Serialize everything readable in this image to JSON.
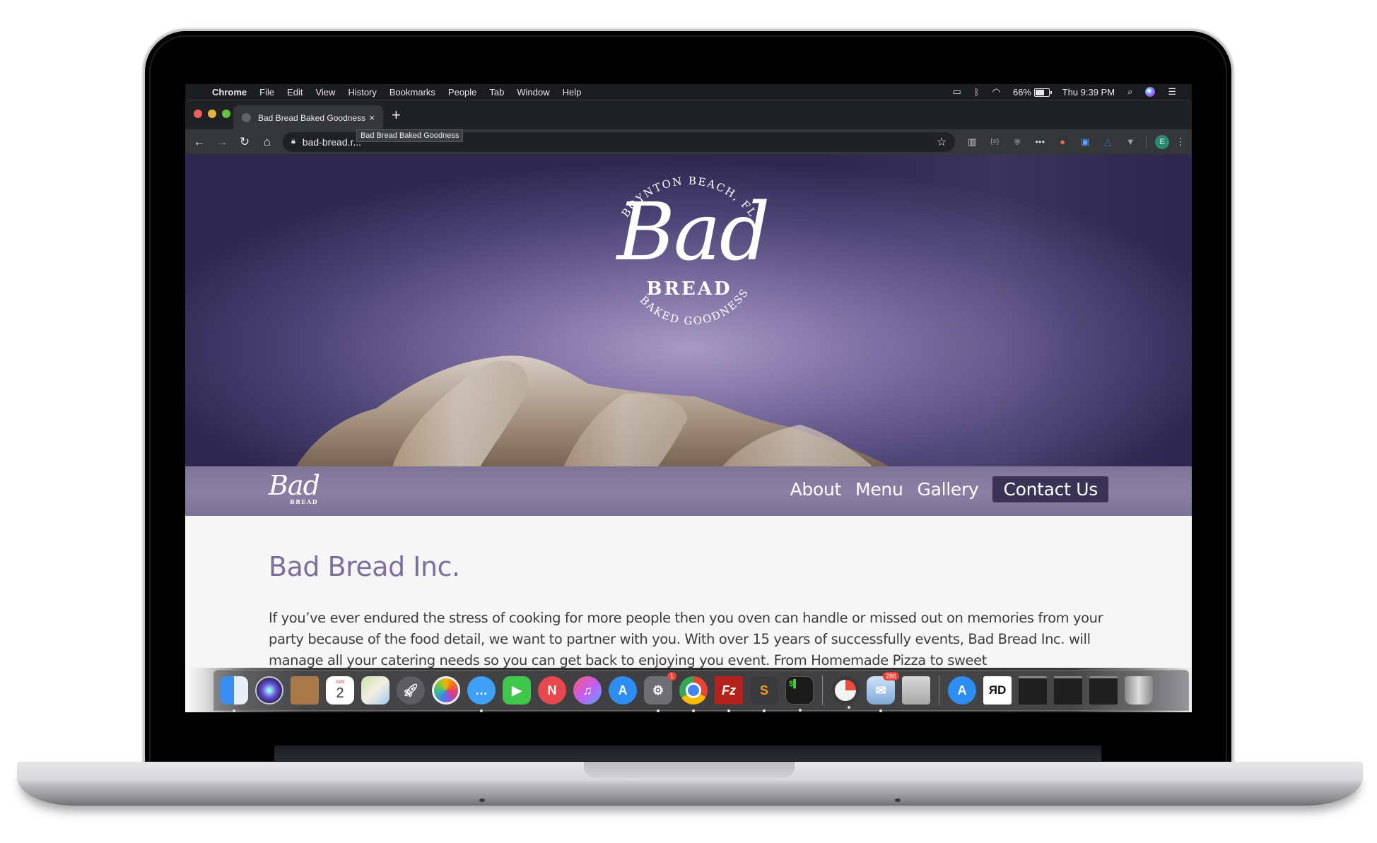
{
  "menubar": {
    "app": "Chrome",
    "items": [
      "File",
      "Edit",
      "View",
      "History",
      "Bookmarks",
      "People",
      "Tab",
      "Window",
      "Help"
    ],
    "battery_percent": "66%",
    "clock": "Thu 9:39 PM",
    "status_icons": [
      "airplay-icon",
      "bluetooth-icon",
      "wifi-icon",
      "battery-icon",
      "spotlight-search-icon",
      "siri-icon",
      "notification-center-icon"
    ]
  },
  "browser": {
    "tab": {
      "title": "Bad Bread Baked Goodness",
      "close": "×"
    },
    "new_tab": "+",
    "url": "bad-bread.r...",
    "tooltip": "Bad Bread Baked Goodness",
    "profile_initial": "E",
    "extensions": [
      "bars-extension",
      "json-extension",
      "react-devtools",
      "dots-extension",
      "color-picker-extension",
      "bootstrap-extension",
      "triangle-extension",
      "vue-devtools"
    ]
  },
  "site": {
    "emblem": {
      "top_arc": "BOYNTON BEACH, FL",
      "script": "Bad",
      "word": "BREAD",
      "bottom_arc": "BAKED GOODNESS"
    },
    "nav_logo": {
      "script": "Bad",
      "word": "BREAD"
    },
    "nav": [
      {
        "label": "About"
      },
      {
        "label": "Menu"
      },
      {
        "label": "Gallery"
      },
      {
        "label": "Contact Us",
        "highlighted": true
      }
    ],
    "heading": "Bad Bread Inc.",
    "intro": "If you’ve ever endured the stress of cooking for more people then you oven can handle or missed out on memories from your party because of the food detail, we want to partner with you. With over 15 years of successfully events, Bad Bread Inc. will manage all your catering needs so you can get back to enjoying you event.  From Homemade Pizza to sweet",
    "colors": {
      "heading": "#7c6f9c",
      "nav_band": "#857a9f",
      "cta": "#3a3356",
      "hero": "#4c4375"
    }
  },
  "dock": {
    "apps": [
      {
        "name": "Finder",
        "running": true
      },
      {
        "name": "Siri"
      },
      {
        "name": "Contacts"
      },
      {
        "name": "Calendar",
        "month": "JAN",
        "day": "2"
      },
      {
        "name": "Maps"
      },
      {
        "name": "Launchpad"
      },
      {
        "name": "Photos"
      },
      {
        "name": "Messages",
        "running": true
      },
      {
        "name": "FaceTime"
      },
      {
        "name": "News"
      },
      {
        "name": "iTunes"
      },
      {
        "name": "App Store"
      },
      {
        "name": "System Preferences",
        "badge": "1",
        "running": true
      },
      {
        "name": "Chrome",
        "running": true
      },
      {
        "name": "FileZilla",
        "running": true
      },
      {
        "name": "Sublime Text",
        "running": true
      },
      {
        "name": "Terminal",
        "running": true
      },
      {
        "name": "Activity Monitor",
        "running": true
      },
      {
        "name": "Mail",
        "badge": "286",
        "running": true
      },
      {
        "name": "Calculator"
      },
      {
        "name": "App Store Folder"
      },
      {
        "name": "RD",
        "label": "ЯD"
      },
      {
        "name": "Sublime Window 1"
      },
      {
        "name": "Sublime Window 2"
      },
      {
        "name": "Sublime Window 3"
      },
      {
        "name": "Trash"
      }
    ]
  }
}
